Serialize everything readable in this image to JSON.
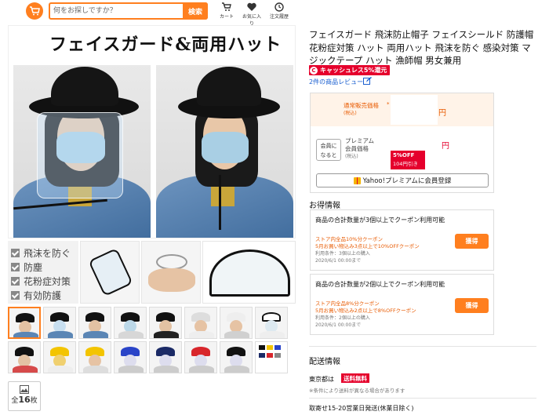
{
  "header": {
    "search_placeholder": "何をお探しですか？",
    "search_button": "検索",
    "nav": [
      {
        "label": "カート",
        "icon": "cart-icon"
      },
      {
        "label": "お気に入り",
        "icon": "heart-icon"
      },
      {
        "label": "注文履歴",
        "icon": "clock-icon"
      }
    ]
  },
  "gallery": {
    "main_title": "フェイスガード&両用ハット",
    "features": [
      "飛沫を防ぐ",
      "防塵",
      "花粉症対策",
      "有効防護"
    ],
    "image_count_prefix": "全",
    "image_count": "16",
    "image_count_suffix": "枚"
  },
  "product": {
    "title": "フェイスガード 飛沫防止帽子 フェイスシールド 防護帽 花粉症対策 ハット 両用ハット 飛沫を防ぐ 感染対策 マジックテープ ハット 漁師帽 男女兼用",
    "cashback_icon": "C",
    "cashback": "キャッシュレス5%還元",
    "review_link": "2件の商品レビュー"
  },
  "price": {
    "normal_label": "通常販売価格",
    "normal_sub": "(税込)",
    "normal_star": "*",
    "normal_yen": "円",
    "member_chip": "会員に なると",
    "premium_label": "プレミアム",
    "premium_label2": "会員価格",
    "premium_sub": "(税込)",
    "premium_yen": "円",
    "off_badge": "5%OFF",
    "off_amount": "104円引き",
    "register_button": "Yahoo!プレミアムに会員登録"
  },
  "deals": {
    "heading": "お得情報",
    "coupons": [
      {
        "title": "商品の合計数量が3個以上でクーポン利用可能",
        "desc1": "ストア内全品10%分クーポン",
        "desc2": "5月お買い物込み3点以上で10%OFFクーポン",
        "meta1": "利用条件：3個以上の購入",
        "meta2": "2020/6/1 00:00まで",
        "button": "獲得"
      },
      {
        "title": "商品の合計数量が2個以上でクーポン利用可能",
        "desc1": "ストア内全品8%分クーポン",
        "desc2": "5月お買い物込み2点以上で8%OFFクーポン",
        "meta1": "利用条件：2個以上の購入",
        "meta2": "2020/6/1 00:00まで",
        "button": "獲得"
      }
    ]
  },
  "shipping": {
    "heading": "配送情報",
    "area": "東京都は",
    "free": "送料無料",
    "note": "※条件により送料が異なる場合があります",
    "days": "取寄せ15-20営業日発送(休業日除く)"
  },
  "colors": {
    "accent": "#ff7f1f",
    "red": "#e5002c",
    "link": "#1a5fd0"
  }
}
